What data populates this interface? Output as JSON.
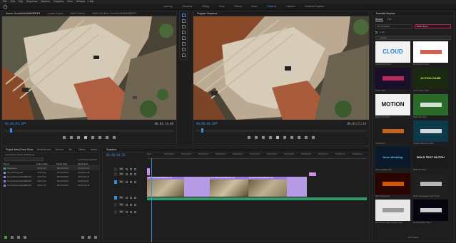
{
  "menu": [
    "File",
    "Edit",
    "Clip",
    "Sequence",
    "Markers",
    "Graphics",
    "View",
    "Window",
    "Help"
  ],
  "workspaces": [
    "Learning",
    "Assembly",
    "Editing",
    "Color",
    "Effects",
    "Audio",
    "Graphics",
    "Libraries",
    "Essential Graphics"
  ],
  "active_workspace": "Graphics",
  "source_panel": {
    "tabs": [
      "Source: DroneShotsN3aN3BE4F4",
      "Lumetri Scopes",
      "Effect Controls",
      "Audio Clip Mixer: DroneShotsN3aN3BE4F4"
    ],
    "timecode_left": "00;00;04;20",
    "timecode_right": "00;03;14;08",
    "fit": "Fit"
  },
  "program_panel": {
    "tabs": [
      "Program: Sequence"
    ],
    "timecode_left": "00;00;04;20",
    "timecode_right": "00;03;21;16",
    "fit": "Fit"
  },
  "project_panel": {
    "tabs": [
      "Project: Aerial Drone Shots 2018",
      "Media Browser",
      "Libraries",
      "Info",
      "Effects",
      "Marker"
    ],
    "project_file": "Aerial Drone Shots 2018.prproj",
    "item_count": "1 of 6 items selected",
    "columns": [
      "Name",
      "Frame Rate",
      "Media Start",
      "Media End"
    ],
    "rows": [
      {
        "name": "Sequence",
        "rate": "29.97 fps",
        "start": "00;00;00;00",
        "end": "00;03;21;15",
        "color": "#3ea34a"
      },
      {
        "name": "SS_Shifting.mp4",
        "rate": "29.97 fps",
        "start": "00;00;00;00",
        "end": "00;00;13;28",
        "color": "#9c7ed8"
      },
      {
        "name": "DroneShotsN3aN3BE4F4",
        "rate": "29.97 fps",
        "start": "00;00;00;00",
        "end": "00;01;18;27",
        "color": "#9c7ed8"
      },
      {
        "name": "DroneShotsN3aN3BE4F5",
        "rate": "29.97 fps",
        "start": "00;00;00;00",
        "end": "00;00;52;11",
        "color": "#9c7ed8"
      },
      {
        "name": "DroneShotsN3aN3BE4F6",
        "rate": "29.97 fps",
        "start": "00;00;00;00",
        "end": "00;00;33;29",
        "color": "#9c7ed8"
      }
    ]
  },
  "timeline": {
    "tab": "Sequence",
    "timecode": "00;00;04;20",
    "ruler": [
      "00;00",
      "00;00;32;00",
      "00;01;04;02",
      "00;01;36;02",
      "00;02;08;04",
      "00;02;40;04",
      "00;03;12;06",
      "00;03;44;06",
      "00;04;16;08",
      "00;04;48;08",
      "00;05;20;10",
      "00;05;52;10",
      "00;06;24;12"
    ],
    "tracks": [
      "V3",
      "V2",
      "V1",
      "A1",
      "A2",
      "A3"
    ],
    "clip_labels": [
      "DroneShotsN3aN3BE4F4.mp4",
      "DroneShotsN3aN3BE4F5.mp4",
      "DroneShotsN3aN3BE4F6.mp4"
    ]
  },
  "essential_graphics": {
    "title": "Essential Graphics",
    "tabs": [
      "Browse",
      "Edit"
    ],
    "active_tab": "Browse",
    "libraries_label": "My Templates",
    "location_label": "Adobe Stock",
    "local_label": "Local",
    "search_placeholder": "Search",
    "tiles": [
      {
        "label": "Actual Word Cloud",
        "text": "CLOUD",
        "bg": "#f2f2f2",
        "fg": "#2b7fd6"
      },
      {
        "label": "Minimal Pitch Card",
        "text": "",
        "bg": "#ffffff",
        "fg": "#c0392b"
      },
      {
        "label": "Promo Titles",
        "text": "",
        "bg": "#1a0f2a",
        "fg": "#e0306a"
      },
      {
        "label": "Action Game Titles",
        "text": "ACTION GAME",
        "bg": "#1a2a12",
        "fg": "#d8e84a"
      },
      {
        "label": "Motion Title Pack",
        "text": "MOTION",
        "bg": "#f0f0f0",
        "fg": "#111111"
      },
      {
        "label": "Bright Title Pack",
        "text": "",
        "bg": "#2a6b2a",
        "fg": "#ffffff"
      },
      {
        "label": "Title Pack 3",
        "text": "",
        "bg": "#1c1c1c",
        "fg": "#e87722"
      },
      {
        "label": "Outdoor Adventure Titles",
        "text": "",
        "bg": "#0d3a4a",
        "fg": "#ffffff"
      },
      {
        "label": "Neon Wedding Title",
        "text": "Neon Wedding",
        "bg": "#0a1a2a",
        "fg": "#5ad0ff"
      },
      {
        "label": "Bold Text Glitch",
        "text": "BOLD TEXT GLITCH",
        "bg": "#1a1a1a",
        "fg": "#ffffff"
      },
      {
        "label": "3D Fire Elements",
        "text": "",
        "bg": "#2a0500",
        "fg": "#ff6a00"
      },
      {
        "label": "Modern Broadcast Lower Thirds",
        "text": "",
        "bg": "#202020",
        "fg": "#dddddd"
      },
      {
        "label": "Decorative Frame Wedding Titles",
        "text": "",
        "bg": "#e8e8e8",
        "fg": "#888888"
      },
      {
        "label": "3D Retro Glitch Titles",
        "text": "",
        "bg": "#050510",
        "fg": "#ffffff"
      }
    ],
    "footer": "3774 Items"
  }
}
